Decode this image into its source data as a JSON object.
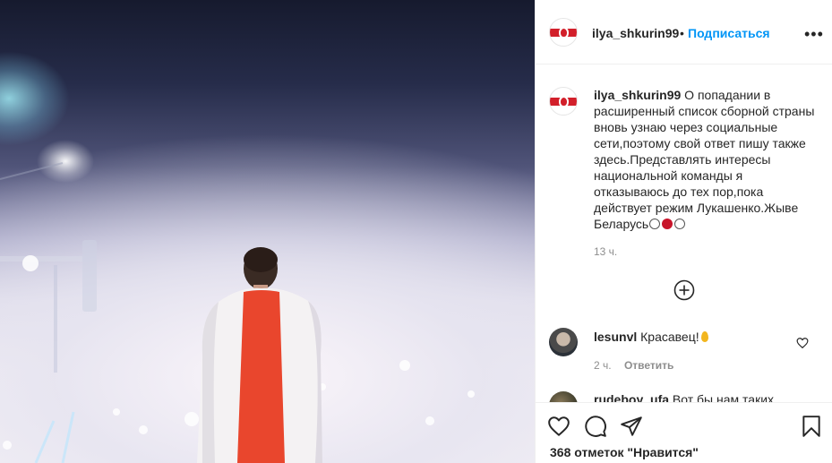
{
  "post": {
    "username": "ilya_shkurin99",
    "follow_label": "Подписаться",
    "separator": "•",
    "more_label": "•••"
  },
  "caption": {
    "username": "ilya_shkurin99",
    "text": "О попадании в расширенный список сборной страны вновь узнаю через социальные сети,поэтому свой ответ пишу также здесь.Представлять интересы национальной команды я отказываюсь до тех пор,пока действует режим Лукашенко.Жыве Беларусь",
    "time": "13 ч."
  },
  "comments": [
    {
      "username": "lesunvl",
      "text": "Красавец!",
      "time": "2 ч.",
      "reply_label": "Ответить"
    },
    {
      "username": "rudeboy_ufa",
      "text": "Вот бы нам таких"
    }
  ],
  "likes": {
    "text": "368 отметок \"Нравится\""
  },
  "icons": {
    "more": "more-options-icon",
    "load_more": "plus-circle-icon",
    "like": "heart-icon",
    "comment": "comment-icon",
    "share": "share-icon",
    "save": "bookmark-icon"
  },
  "colors": {
    "accent": "#0095f6",
    "flag_red": "#d21f2a",
    "secondary_text": "#8e8e8e"
  }
}
